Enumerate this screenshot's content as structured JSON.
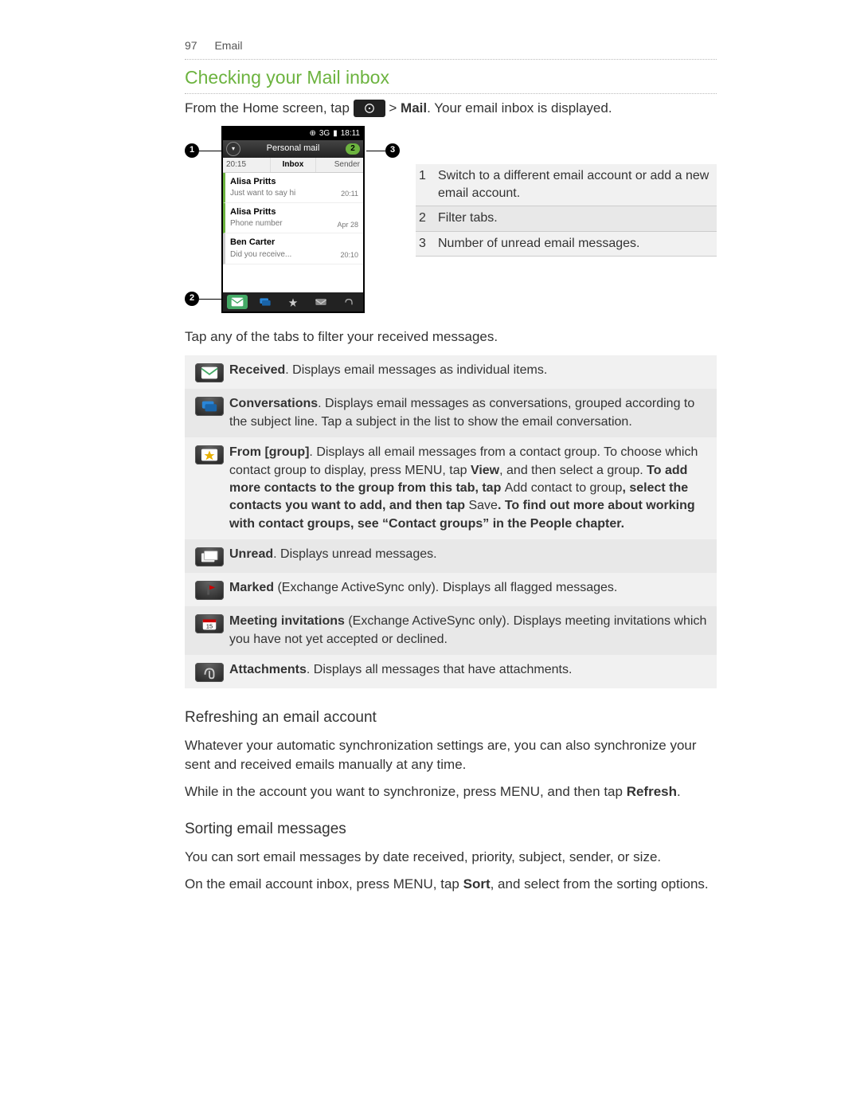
{
  "header": {
    "page_number": "97",
    "chapter": "Email"
  },
  "section_title": "Checking your Mail inbox",
  "intro": {
    "before_icon": "From the Home screen, tap ",
    "after_icon_prefix": " > ",
    "after_icon_bold": "Mail",
    "after_icon_suffix": ". Your email inbox is displayed."
  },
  "phone": {
    "status_time": "18:11",
    "status_left": "3G",
    "title": "Personal mail",
    "badge": "2",
    "tabs": {
      "left": "20:15",
      "center": "Inbox",
      "right": "Sender"
    },
    "messages": [
      {
        "from": "Alisa Pritts",
        "subject": "Just want to say hi",
        "time": "20:11"
      },
      {
        "from": "Alisa Pritts",
        "subject": "Phone number",
        "time": "Apr 28"
      },
      {
        "from": "Ben Carter",
        "subject": "Did you receive...",
        "time": "20:10"
      }
    ]
  },
  "callouts": [
    {
      "num": "1",
      "text": "Switch to a different email account or add a new email account."
    },
    {
      "num": "2",
      "text": "Filter tabs."
    },
    {
      "num": "3",
      "text": "Number of unread email messages."
    }
  ],
  "tap_tabs_line": "Tap any of the tabs to filter your received messages.",
  "tabs": [
    {
      "icon": "received",
      "bold": "Received",
      "body": ". Displays email messages as individual items."
    },
    {
      "icon": "conversations",
      "bold": "Conversations",
      "body": ". Displays email messages as conversations, grouped according to the subject line. Tap a subject in the list to show the email conversation."
    },
    {
      "icon": "group",
      "bold": "From [group]",
      "body_parts": [
        ". Displays all email messages from a contact group. To choose which contact group to display, press MENU, tap ",
        "View",
        ", and then select a group.",
        "\nTo add more contacts to the group from this tab, tap ",
        "Add contact to group",
        ", select the contacts you want to add, and then tap ",
        "Save",
        ". To find out more about working with contact groups, see “Contact groups” in the People chapter."
      ]
    },
    {
      "icon": "unread",
      "bold": "Unread",
      "body": ". Displays unread messages."
    },
    {
      "icon": "marked",
      "bold": "Marked",
      "paren": " (Exchange ActiveSync only)",
      "body": ". Displays all flagged messages."
    },
    {
      "icon": "meeting",
      "bold": "Meeting invitations",
      "paren": " (Exchange ActiveSync only)",
      "body": ". Displays meeting invitations which you have not yet accepted or declined."
    },
    {
      "icon": "attach",
      "bold": "Attachments",
      "body": ". Displays all messages that have attachments."
    }
  ],
  "refresh": {
    "heading": "Refreshing an email account",
    "p1": "Whatever your automatic synchronization settings are, you can also synchronize your sent and received emails manually at any time.",
    "p2_before": "While in the account you want to synchronize, press MENU, and then tap ",
    "p2_bold": "Refresh",
    "p2_after": "."
  },
  "sorting": {
    "heading": "Sorting email messages",
    "p1": "You can sort email messages by date received, priority, subject, sender, or size.",
    "p2_before": "On the email account inbox, press MENU, tap ",
    "p2_bold": "Sort",
    "p2_after": ", and select from the sorting options."
  }
}
